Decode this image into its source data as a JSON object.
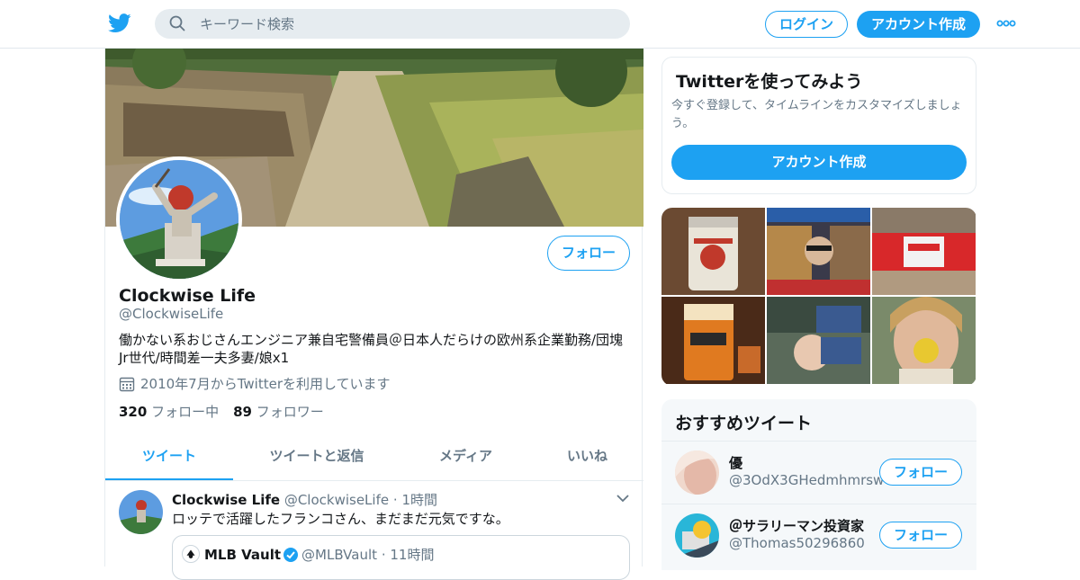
{
  "header": {
    "search_placeholder": "キーワード検索",
    "login_label": "ログイン",
    "signup_label": "アカウント作成",
    "brand_color": "#1da1f2"
  },
  "profile": {
    "follow_label": "フォロー",
    "name": "Clockwise Life",
    "handle": "@ClockwiseLife",
    "bio": "働かない系おじさんエンジニア兼自宅警備員＠日本人だらけの欧州系企業勤務/団塊Jr世代/時間差一夫多妻/娘x1",
    "joined": "2010年7月からTwitterを利用しています",
    "following_count": "320",
    "following_label": "フォロー中",
    "followers_count": "89",
    "followers_label": "フォロワー"
  },
  "tabs": [
    {
      "label": "ツイート",
      "active": true
    },
    {
      "label": "ツイートと返信",
      "active": false
    },
    {
      "label": "メディア",
      "active": false
    },
    {
      "label": "いいね",
      "active": false
    }
  ],
  "tweet": {
    "name": "Clockwise Life",
    "handle": "@ClockwiseLife",
    "time": "1時間",
    "text": "ロッテで活躍したフランコさん、まだまだ元気ですな。",
    "quote": {
      "name": "MLB Vault",
      "handle": "@MLBVault",
      "time": "11時間"
    }
  },
  "signup_card": {
    "title": "Twitterを使ってみよう",
    "subtitle": "今すぐ登録して、タイムラインをカスタマイズしましょう。",
    "button": "アカウント作成"
  },
  "recommended": {
    "title": "おすすめツイート",
    "accounts": [
      {
        "name": "優",
        "handle": "@3OdX3GHedmhmrsw",
        "follow": "フォロー"
      },
      {
        "name": "＠サラリーマン投資家",
        "handle": "@Thomas50296860",
        "follow": "フォロー"
      }
    ]
  }
}
